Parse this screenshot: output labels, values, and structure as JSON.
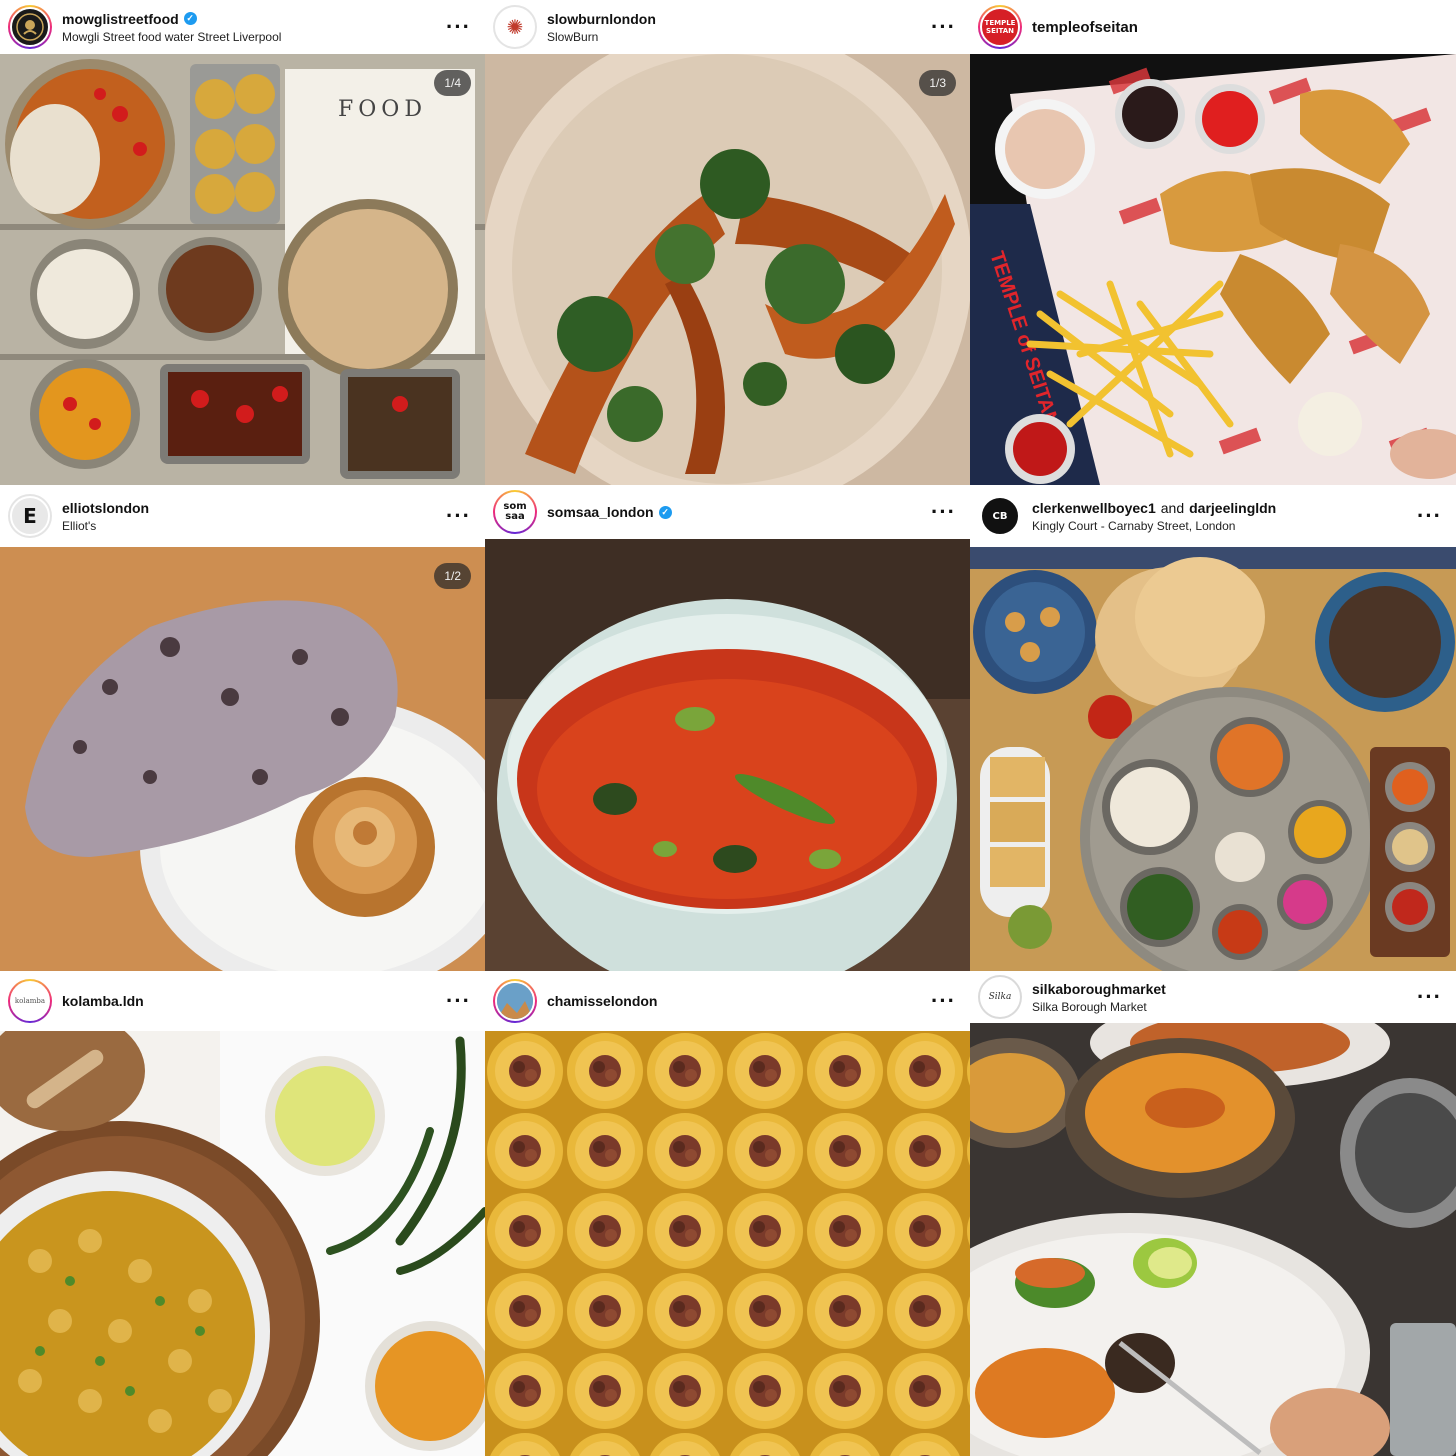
{
  "posts": [
    {
      "username": "mowglistreetfood",
      "verified": true,
      "location": "Mowgli Street food water Street Liverpool",
      "counter": "1/4",
      "avatar": {
        "text": "",
        "bg": "#1a1a1a",
        "fg": "#c9a55a"
      },
      "photo": {
        "subject": "thali dishes on steel trays",
        "menu_text": "FOOD"
      }
    },
    {
      "username": "slowburnlondon",
      "verified": false,
      "location": "SlowBurn",
      "counter": "1/3",
      "avatar": {
        "text": "✺",
        "bg": "#ffffff",
        "fg": "#c0392b"
      },
      "photo": {
        "subject": "roasted squash with kale on plate"
      }
    },
    {
      "username": "templeofseitan",
      "verified": false,
      "location": "",
      "counter": "",
      "avatar": {
        "text": "TEMPLE SEITAN",
        "bg": "#d61f26",
        "fg": "#ffffff"
      },
      "photo": {
        "subject": "fried seitan strips and fries",
        "brand_text": "TEMPLE of SEITAN"
      }
    },
    {
      "username": "elliotslondon",
      "verified": false,
      "location": "Elliot's",
      "counter": "1/2",
      "avatar": {
        "text": "E",
        "bg": "#e8e8e8",
        "fg": "#111111"
      },
      "photo": {
        "subject": "charred flatbread with pastry"
      }
    },
    {
      "username": "somsaa_london",
      "verified": true,
      "location": "",
      "counter": "",
      "avatar": {
        "text": "som saa",
        "bg": "#ffffff",
        "fg": "#111111"
      },
      "photo": {
        "subject": "red curry in pale bowl"
      }
    },
    {
      "username": "clerkenwellboyec1",
      "and_text": "and",
      "second_username": "darjeelingldn",
      "verified": false,
      "location": "Kingly Court - Carnaby Street, London",
      "counter": "",
      "avatar": {
        "text": "CB",
        "bg": "#111111",
        "fg": "#ffffff"
      },
      "photo": {
        "subject": "indian spread with paratha and curries"
      }
    },
    {
      "username": "kolamba.ldn",
      "verified": false,
      "location": "",
      "counter": "",
      "avatar": {
        "text": "kolamba",
        "bg": "#ffffff",
        "fg": "#555555"
      },
      "photo": {
        "subject": "cashew curry, dhal and green chillies"
      }
    },
    {
      "username": "chamisselondon",
      "verified": false,
      "location": "",
      "counter": "",
      "avatar": {
        "text": "",
        "bg": "#6aa0c8",
        "fg": "#ffffff"
      },
      "photo": {
        "subject": "vermicelli nests with pistachios"
      }
    },
    {
      "username": "silkaboroughmarket",
      "verified": false,
      "location": "Silka Borough Market",
      "counter": "",
      "avatar": {
        "text": "Silka",
        "bg": "#ffffff",
        "fg": "#333333"
      },
      "photo": {
        "subject": "prawn plate with curry bowls"
      }
    }
  ]
}
